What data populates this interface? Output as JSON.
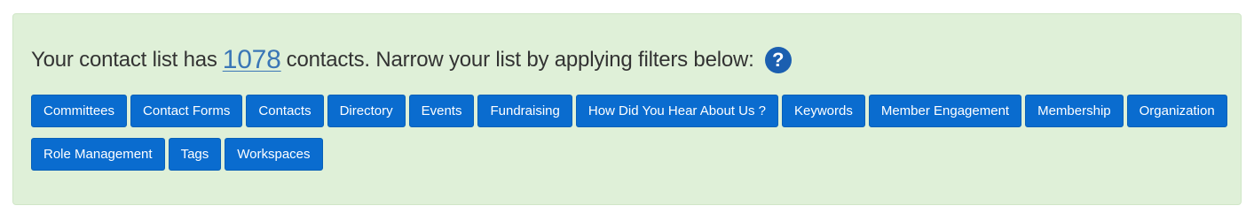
{
  "summary": {
    "prefix": "Your contact list has",
    "count": "1078",
    "suffix": "contacts. Narrow your list by applying filters below:",
    "help_icon": "question-circle-icon",
    "help_glyph": "?"
  },
  "filters": {
    "buttons": [
      "Committees",
      "Contact Forms",
      "Contacts",
      "Directory",
      "Events",
      "Fundraising",
      "How Did You Hear About Us ?",
      "Keywords",
      "Member Engagement",
      "Membership",
      "Organization",
      "Role Management",
      "Tags",
      "Workspaces"
    ]
  },
  "colors": {
    "panel_bg": "#dff0d8",
    "button_bg": "#0a6ccf",
    "link": "#3a76b6",
    "help_icon": "#1b5fb0"
  }
}
